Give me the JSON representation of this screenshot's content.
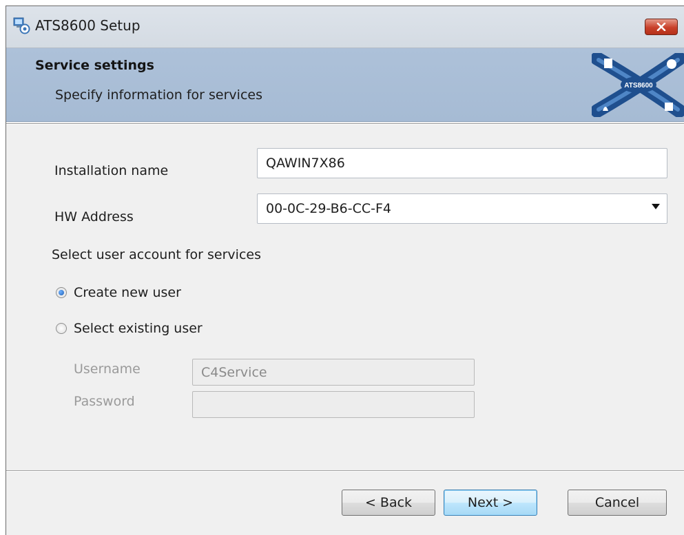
{
  "window": {
    "title": "ATS8600 Setup",
    "icons": {
      "app": "setup-app-icon",
      "close": "close-icon"
    }
  },
  "banner": {
    "title": "Service settings",
    "subtitle": "Specify information for services",
    "logo_text": "ATS8600"
  },
  "form": {
    "installation_name": {
      "label": "Installation name",
      "value": "QAWIN7X86"
    },
    "hw_address": {
      "label": "HW Address",
      "selected": "00-0C-29-B6-CC-F4"
    },
    "account_prompt": "Select user account for services",
    "options": [
      {
        "label": "Create new user",
        "checked": true
      },
      {
        "label": "Select existing user",
        "checked": false
      }
    ],
    "username": {
      "label": "Username",
      "value": "C4Service",
      "disabled": true
    },
    "password": {
      "label": "Password",
      "value": "",
      "disabled": true
    }
  },
  "buttons": {
    "back": "< Back",
    "next": "Next >",
    "cancel": "Cancel"
  },
  "colors": {
    "banner": "#a6bbd4",
    "close": "#c9402a",
    "accent": "#1f5fb4",
    "dialog": "#f0f0f0"
  }
}
